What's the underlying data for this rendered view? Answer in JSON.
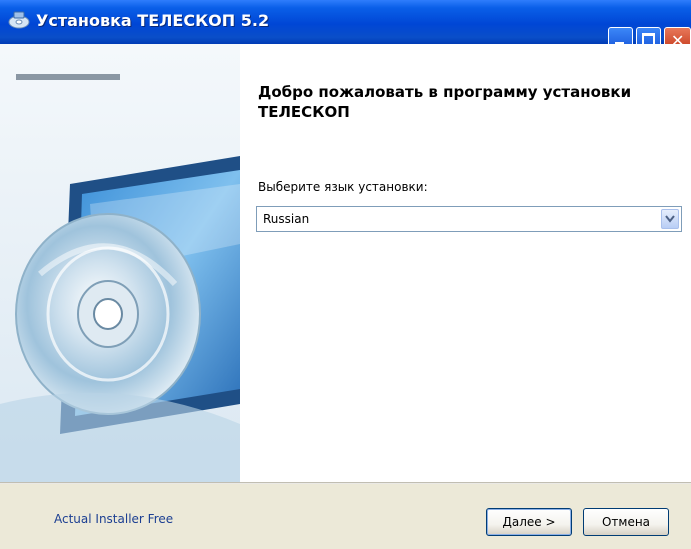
{
  "window": {
    "title": "Установка ТЕЛЕСКОП 5.2"
  },
  "content": {
    "heading": "Добро пожаловать в программу установки ТЕЛЕСКОП",
    "language_label": "Выберите язык установки:",
    "language_selected": "Russian"
  },
  "footer": {
    "brand": "Actual Installer Free",
    "next_label": "Далее >",
    "cancel_label": "Отмена"
  },
  "icons": {
    "app": "installer-icon",
    "minimize": "minimize-icon",
    "maximize": "maximize-icon",
    "close": "close-icon",
    "dropdown": "chevron-down-icon"
  },
  "colors": {
    "titlebar": "#0a4ec8",
    "background": "#ece9d8",
    "link": "#1c3f92"
  }
}
